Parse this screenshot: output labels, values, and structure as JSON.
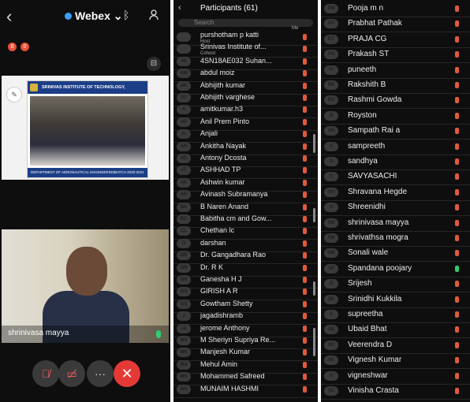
{
  "meeting": {
    "app_title": "Webex",
    "badges": [
      "8",
      "0"
    ],
    "share": {
      "institute": "SRINIVAS INSTITUTE OF TECHNOLOGY, MANGALURU",
      "department": "DEPARTMENT OF AERONAUTICAL ENGINEERING",
      "batch": "BATCH 2020-2021"
    },
    "speaker_name": "shrinivasa mayya",
    "controls": {
      "mute": "mute-icon",
      "video": "video-off-icon",
      "more": "···",
      "end": "✕"
    }
  },
  "participants": {
    "title": "Participants (61)",
    "search_placeholder": "Search",
    "me_label": "Me",
    "colors": {
      "muted": "#e05a3a",
      "unmuted": "#2ecc71"
    },
    "list_a": [
      {
        "name": "purshotham p katti",
        "sub": "Host",
        "avatar": ""
      },
      {
        "name": "Srinivas Institute of...",
        "sub": "Cohost",
        "avatar": ""
      },
      {
        "name": "4SN18AE032 Suhan...",
        "avatar": "4S"
      },
      {
        "name": "abdul moiz",
        "avatar": "AM"
      },
      {
        "name": "Abhijith kumar",
        "avatar": "AK"
      },
      {
        "name": "Abhijith varghese",
        "avatar": "AV"
      },
      {
        "name": "amitkumar.h3",
        "avatar": "A"
      },
      {
        "name": "Anil Prem Pinto",
        "avatar": "AP"
      },
      {
        "name": "Anjali",
        "avatar": "A"
      },
      {
        "name": "Ankitha Nayak",
        "avatar": "AN"
      },
      {
        "name": "Antony Dcosta",
        "avatar": "AD"
      },
      {
        "name": "ASHHAD TP",
        "avatar": "AT"
      },
      {
        "name": "Ashwin kumar",
        "avatar": "AK"
      },
      {
        "name": "Avinash Subramanya",
        "avatar": "AS"
      },
      {
        "name": "B Naren Anand",
        "avatar": "BA"
      },
      {
        "name": "Babitha cm and Gow...",
        "avatar": "BC"
      },
      {
        "name": "Chethan lc",
        "avatar": "CL"
      },
      {
        "name": "darshan",
        "avatar": "D"
      },
      {
        "name": "Dr. Gangadhara Rao",
        "avatar": "DR"
      },
      {
        "name": "Dr. R K",
        "avatar": "DR"
      },
      {
        "name": "Ganesha H J",
        "avatar": "GH"
      },
      {
        "name": "GIRISH A R",
        "avatar": "GA"
      },
      {
        "name": "Gowtham Shetty",
        "avatar": "GS"
      },
      {
        "name": "jagadishramb",
        "avatar": "J"
      },
      {
        "name": "jerome Anthony",
        "avatar": "JA"
      },
      {
        "name": "M Sheriyn Supriya Re...",
        "avatar": "MS"
      },
      {
        "name": "Manjesh Kumar",
        "avatar": "MK"
      },
      {
        "name": "Mehul Amin",
        "avatar": "MA"
      },
      {
        "name": "Mohammed Safreed",
        "avatar": "MS"
      },
      {
        "name": "MUNAIM HASHMI",
        "avatar": "MH"
      }
    ],
    "list_b": [
      {
        "name": "Pooja m n",
        "avatar": "PM"
      },
      {
        "name": "Prabhat Pathak",
        "avatar": "PP"
      },
      {
        "name": "PRAJA CG",
        "avatar": "PC"
      },
      {
        "name": "Prakash ST",
        "avatar": "PS"
      },
      {
        "name": "puneeth",
        "avatar": "P"
      },
      {
        "name": "Rakshith B",
        "avatar": "RB"
      },
      {
        "name": "Rashmi Gowda",
        "avatar": "RG"
      },
      {
        "name": "Royston",
        "avatar": "R"
      },
      {
        "name": "Sampath Rai a",
        "avatar": "SR"
      },
      {
        "name": "sampreeth",
        "avatar": "S"
      },
      {
        "name": "sandhya",
        "avatar": "S"
      },
      {
        "name": "SAVYASACHI",
        "avatar": "S"
      },
      {
        "name": "Shravana Hegde",
        "avatar": "SH"
      },
      {
        "name": "Shreenidhi",
        "avatar": "S"
      },
      {
        "name": "shrinivasa mayya",
        "avatar": "SM"
      },
      {
        "name": "shrivathsa mogra",
        "avatar": "SM"
      },
      {
        "name": "Sonali wale",
        "avatar": "SW"
      },
      {
        "name": "Spandana poojary",
        "avatar": "SP",
        "unmuted": true
      },
      {
        "name": "Srijesh",
        "avatar": "S"
      },
      {
        "name": "Srinidhi Kukkila",
        "avatar": "SK"
      },
      {
        "name": "supreetha",
        "avatar": "S"
      },
      {
        "name": "Ubaid Bhat",
        "avatar": "UB"
      },
      {
        "name": "Veerendra D",
        "avatar": "VD"
      },
      {
        "name": "Vignesh Kumar",
        "avatar": "VK"
      },
      {
        "name": "vigneshwar",
        "avatar": "V"
      },
      {
        "name": "Vinisha Crasta",
        "avatar": "VC"
      }
    ]
  }
}
